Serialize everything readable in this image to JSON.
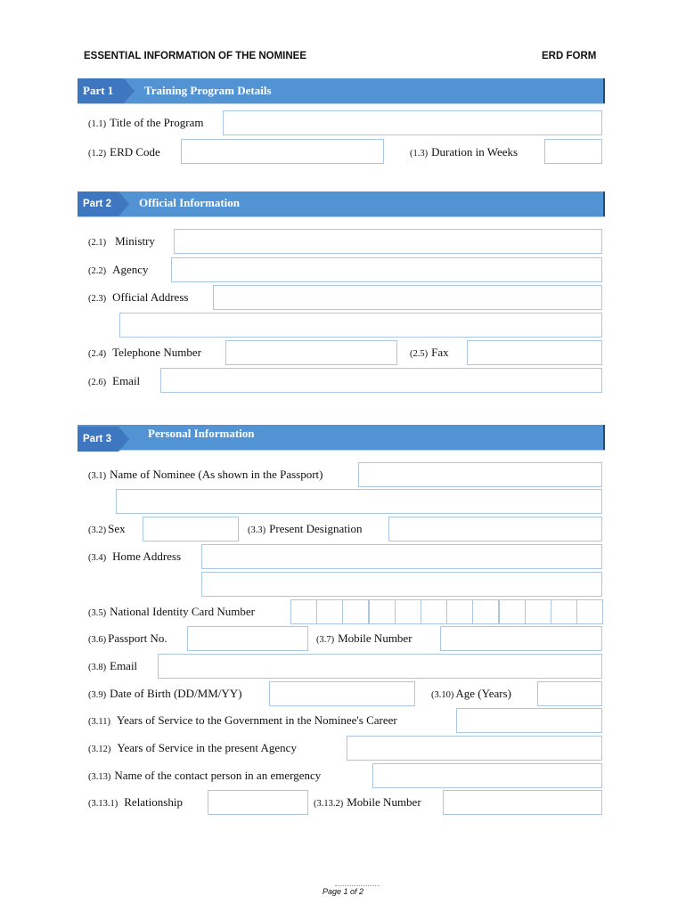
{
  "header": {
    "title": "ESSENTIAL INFORMATION OF THE NOMINEE",
    "form_code": "ERD  FORM"
  },
  "parts": [
    {
      "label": "Part 1",
      "title": "Training Program Details"
    },
    {
      "label": "Part 2",
      "title": "Official Information"
    },
    {
      "label": "Part 3",
      "title": "Personal Information"
    }
  ],
  "fields": {
    "f1_1": {
      "num": "(1.1)",
      "label": "Title of the Program",
      "value": ""
    },
    "f1_2": {
      "num": "(1.2)",
      "label": "ERD Code",
      "value": ""
    },
    "f1_3": {
      "num": "(1.3)",
      "label": "Duration in Weeks",
      "value": ""
    },
    "f2_1": {
      "num": "(2.1)",
      "label": "Ministry",
      "value": ""
    },
    "f2_2": {
      "num": "(2.2)",
      "label": "Agency",
      "value": ""
    },
    "f2_3": {
      "num": "(2.3)",
      "label": "Official Address",
      "value": "",
      "value2": ""
    },
    "f2_4": {
      "num": "(2.4)",
      "label": "Telephone Number",
      "value": ""
    },
    "f2_5": {
      "num": "(2.5)",
      "label": "Fax",
      "value": ""
    },
    "f2_6": {
      "num": "(2.6)",
      "label": "Email",
      "value": ""
    },
    "f3_1": {
      "num": "(3.1)",
      "label": "Name of Nominee (As shown in the Passport)",
      "value": "",
      "value2": ""
    },
    "f3_2": {
      "num": "(3.2)",
      "label": "Sex",
      "value": ""
    },
    "f3_3": {
      "num": "(3.3)",
      "label": "Present Designation",
      "value": ""
    },
    "f3_4": {
      "num": "(3.4)",
      "label": "Home Address",
      "value": "",
      "value2": ""
    },
    "f3_5": {
      "num": "(3.5)",
      "label": "National Identity Card Number",
      "cells": 12
    },
    "f3_6": {
      "num": "(3.6)",
      "label": "Passport No.",
      "value": ""
    },
    "f3_7": {
      "num": "(3.7)",
      "label": "Mobile Number",
      "value": ""
    },
    "f3_8": {
      "num": "(3.8)",
      "label": "Email",
      "value": ""
    },
    "f3_9": {
      "num": "(3.9)",
      "label": "Date of Birth (DD/MM/YY)",
      "value": ""
    },
    "f3_10": {
      "num": "(3.10)",
      "label": "Age (Years)",
      "value": ""
    },
    "f3_11": {
      "num": "(3.11)",
      "label": "Years of Service to the Government in the Nominee's Career",
      "value": ""
    },
    "f3_12": {
      "num": "(3.12)",
      "label": "Years of Service in the present Agency",
      "value": ""
    },
    "f3_13": {
      "num": "(3.13)",
      "label": "Name of the contact person in an emergency",
      "value": ""
    },
    "f3_13_1": {
      "num": "(3.13.1)",
      "label": "Relationship",
      "value": ""
    },
    "f3_13_2": {
      "num": "(3.13.2)",
      "label": "Mobile Number",
      "value": ""
    }
  },
  "footer": {
    "page": "Page 1 of 2"
  }
}
